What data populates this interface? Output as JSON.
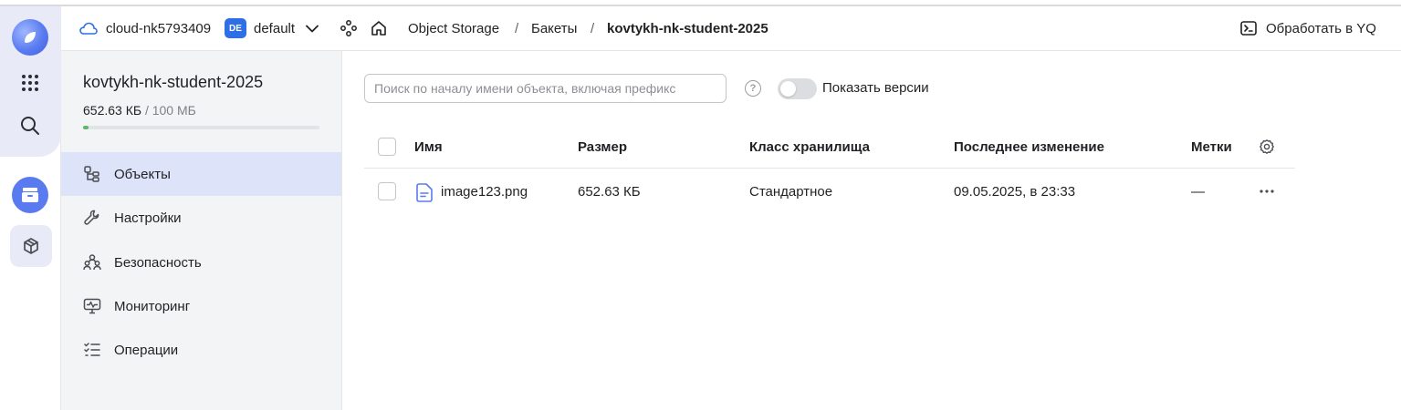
{
  "header": {
    "cloud_name": "cloud-nk5793409",
    "folder_badge": "DE",
    "folder_name": "default",
    "breadcrumb": [
      "Object Storage",
      "Бакеты",
      "kovtykh-nk-student-2025"
    ],
    "breadcrumb_separator": "/",
    "yq_button": "Обработать в YQ"
  },
  "sidebar": {
    "bucket_name": "kovtykh-nk-student-2025",
    "usage_used": "652.63 КБ",
    "usage_limit": "/ 100 МБ",
    "usage_fraction": 0.0064,
    "items": [
      {
        "label": "Объекты",
        "icon": "objects-icon",
        "active": true
      },
      {
        "label": "Настройки",
        "icon": "wrench-icon",
        "active": false
      },
      {
        "label": "Безопасность",
        "icon": "people-icon",
        "active": false
      },
      {
        "label": "Мониторинг",
        "icon": "monitor-icon",
        "active": false
      },
      {
        "label": "Операции",
        "icon": "list-check-icon",
        "active": false
      }
    ]
  },
  "main": {
    "search_placeholder": "Поиск по началу имени объекта, включая префикс",
    "help_glyph": "?",
    "show_versions_label": "Показать версии",
    "show_versions": false,
    "columns": [
      "Имя",
      "Размер",
      "Класс хранилища",
      "Последнее изменение",
      "Метки"
    ],
    "rows": [
      {
        "name": "image123.png",
        "size": "652.63 КБ",
        "storage_class": "Стандартное",
        "modified": "09.05.2025, в 23:33",
        "labels": "—",
        "actions": "···"
      }
    ]
  },
  "colors": {
    "accent": "#5a7bf0",
    "active_nav": "#dde3f8",
    "usage_bar": "#5fb86b",
    "badge": "#2f6fe6"
  }
}
